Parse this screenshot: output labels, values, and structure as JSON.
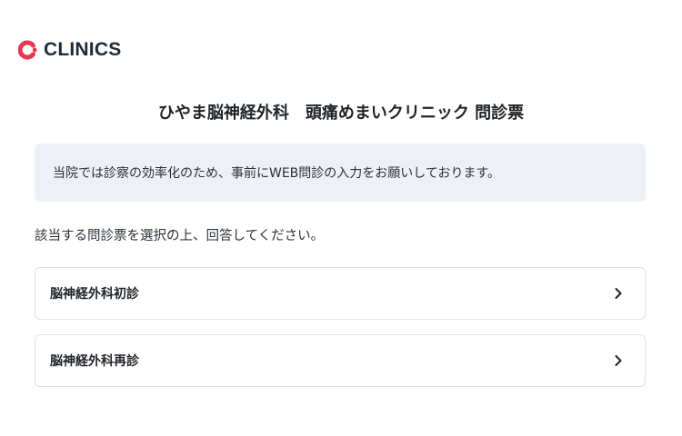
{
  "brand": {
    "name": "CLINICS",
    "color": "#e8384f"
  },
  "page": {
    "title": "ひやま脳神経外科　頭痛めまいクリニック 問診票",
    "notice": "当院では診察の効率化のため、事前にWEB問診の入力をお願いしております。",
    "instruction": "該当する問診票を選択の上、回答してください。"
  },
  "questionnaires": [
    {
      "label": "脳神経外科初診",
      "icon": "chevron-right-icon"
    },
    {
      "label": "脳神経外科再診",
      "icon": "chevron-right-icon"
    }
  ]
}
